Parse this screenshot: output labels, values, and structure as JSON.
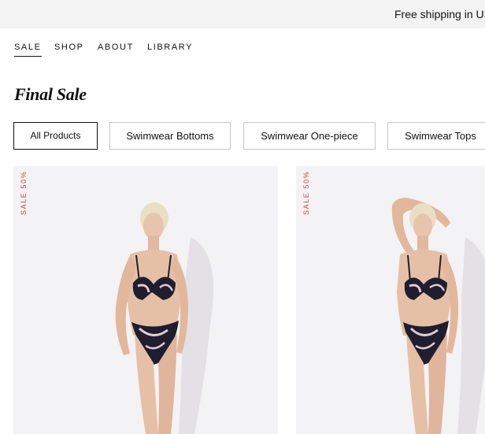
{
  "announcement": {
    "text": "Free shipping in US o"
  },
  "nav": {
    "items": [
      {
        "label": "SALE",
        "active": true
      },
      {
        "label": "SHOP"
      },
      {
        "label": "ABOUT"
      },
      {
        "label": "LIBRARY"
      }
    ]
  },
  "page": {
    "title": "Final Sale"
  },
  "filters": [
    {
      "label": "All Products",
      "active": true
    },
    {
      "label": "Swimwear Bottoms"
    },
    {
      "label": "Swimwear One-piece"
    },
    {
      "label": "Swimwear Tops"
    }
  ],
  "products": [
    {
      "badge": "SALE 50%",
      "image": "model-bikini-photo"
    },
    {
      "badge": "SALE 50%",
      "image": "model-bikini-arm-raised-photo"
    }
  ],
  "colors": {
    "announcement_bg": "#f3f3f3",
    "card_bg": "#f3f2f4",
    "sale_badge": "#d4483b",
    "swim_print_dark": "#1f1e2e",
    "swim_print_light": "#e6c8d2"
  }
}
